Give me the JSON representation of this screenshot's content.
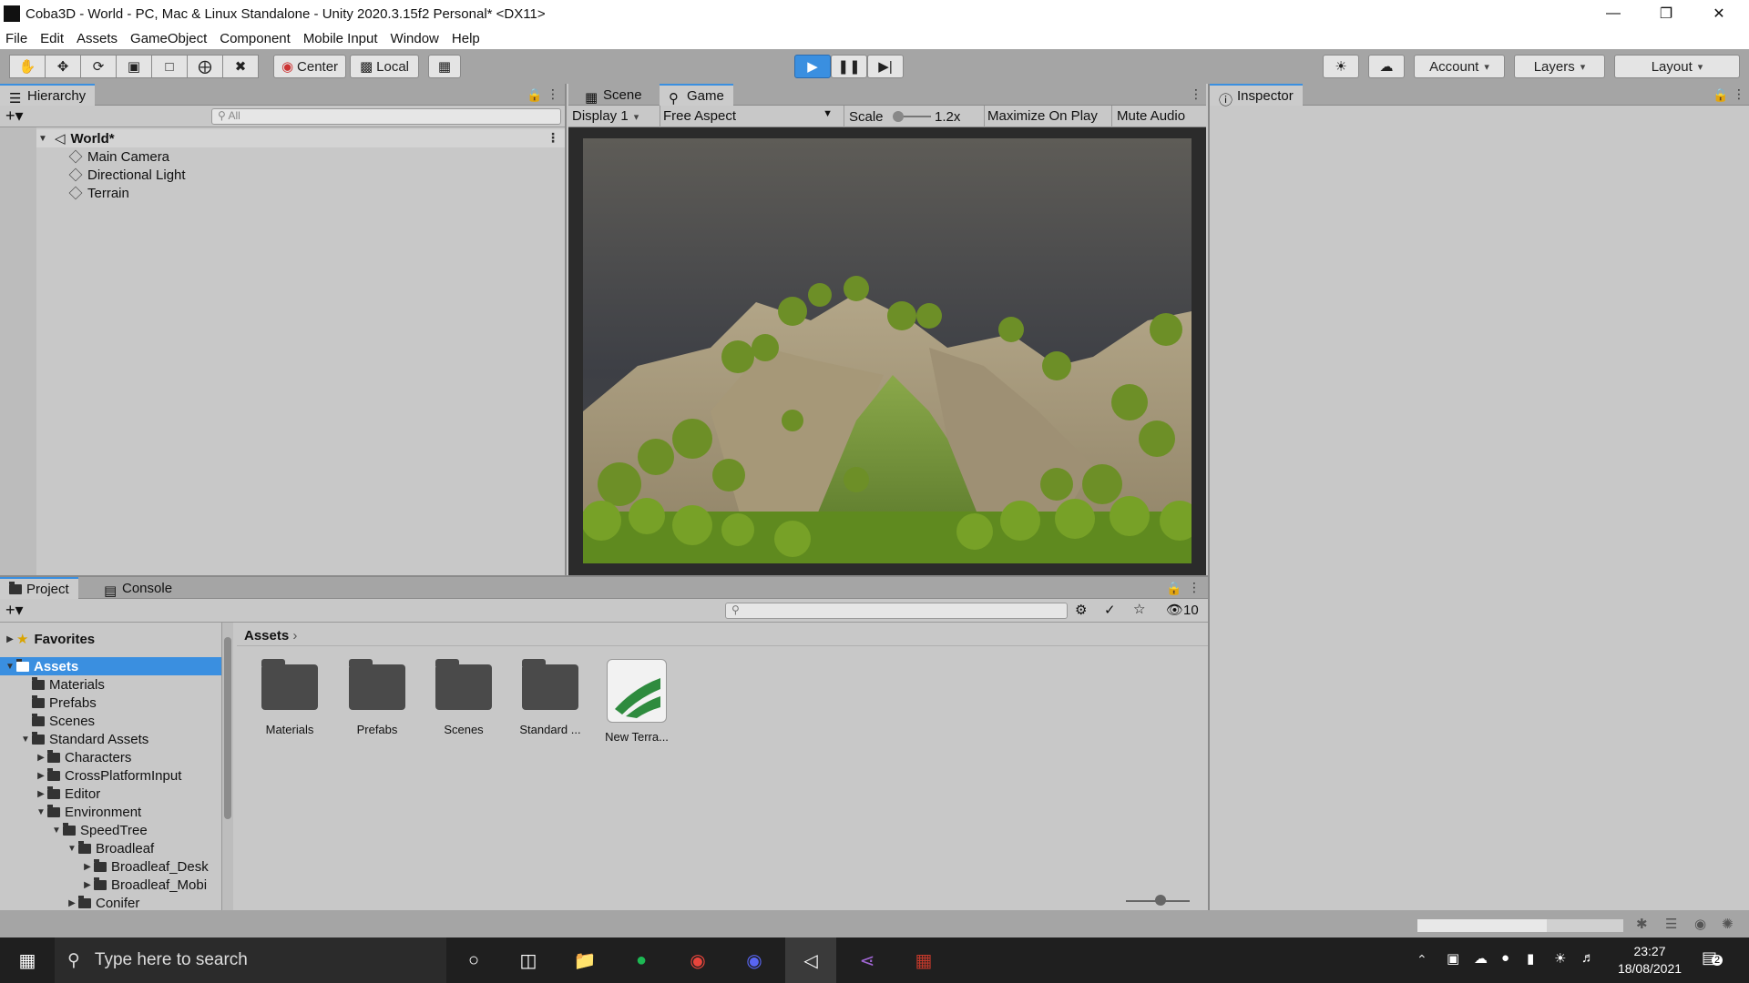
{
  "window": {
    "title": "Coba3D - World - PC, Mac & Linux Standalone - Unity 2020.3.15f2 Personal* <DX11>"
  },
  "menu": [
    "File",
    "Edit",
    "Assets",
    "GameObject",
    "Component",
    "Mobile Input",
    "Window",
    "Help"
  ],
  "toolbar": {
    "center_label": "Center",
    "local_label": "Local",
    "account_label": "Account",
    "layers_label": "Layers",
    "layout_label": "Layout"
  },
  "hierarchy": {
    "tab_label": "Hierarchy",
    "search_placeholder": "All",
    "scene_name": "World*",
    "items": [
      "Main Camera",
      "Directional Light",
      "Terrain"
    ]
  },
  "view_tabs": {
    "scene_label": "Scene",
    "game_label": "Game"
  },
  "game_bar": {
    "display": "Display 1",
    "aspect": "Free Aspect",
    "scale_label": "Scale",
    "scale_value": "1.2x",
    "maximize_label": "Maximize On Play",
    "mute_label": "Mute Audio"
  },
  "inspector": {
    "tab_label": "Inspector"
  },
  "project": {
    "tab_label": "Project",
    "console_label": "Console",
    "hidden_count": "10",
    "breadcrumb": "Assets",
    "favorites_label": "Favorites",
    "tree": [
      {
        "label": "Assets",
        "depth": 0,
        "arrow": "open",
        "selected": true
      },
      {
        "label": "Materials",
        "depth": 1,
        "arrow": "none"
      },
      {
        "label": "Prefabs",
        "depth": 1,
        "arrow": "none"
      },
      {
        "label": "Scenes",
        "depth": 1,
        "arrow": "none"
      },
      {
        "label": "Standard Assets",
        "depth": 1,
        "arrow": "open"
      },
      {
        "label": "Characters",
        "depth": 2,
        "arrow": "closed"
      },
      {
        "label": "CrossPlatformInput",
        "depth": 2,
        "arrow": "closed"
      },
      {
        "label": "Editor",
        "depth": 2,
        "arrow": "closed"
      },
      {
        "label": "Environment",
        "depth": 2,
        "arrow": "open"
      },
      {
        "label": "SpeedTree",
        "depth": 3,
        "arrow": "open"
      },
      {
        "label": "Broadleaf",
        "depth": 4,
        "arrow": "open"
      },
      {
        "label": "Broadleaf_Desk",
        "depth": 5,
        "arrow": "closed"
      },
      {
        "label": "Broadleaf_Mobi",
        "depth": 5,
        "arrow": "closed"
      },
      {
        "label": "Conifer",
        "depth": 4,
        "arrow": "closed"
      }
    ],
    "assets": [
      "Materials",
      "Prefabs",
      "Scenes",
      "Standard ...",
      "New Terra..."
    ]
  },
  "taskbar": {
    "search_placeholder": "Type here to search",
    "time": "23:27",
    "date": "18/08/2021",
    "notification_count": "2"
  },
  "colors": {
    "accent": "#3a8fe0",
    "panel": "#c8c8c8",
    "toolbar": "#a5a5a5"
  }
}
